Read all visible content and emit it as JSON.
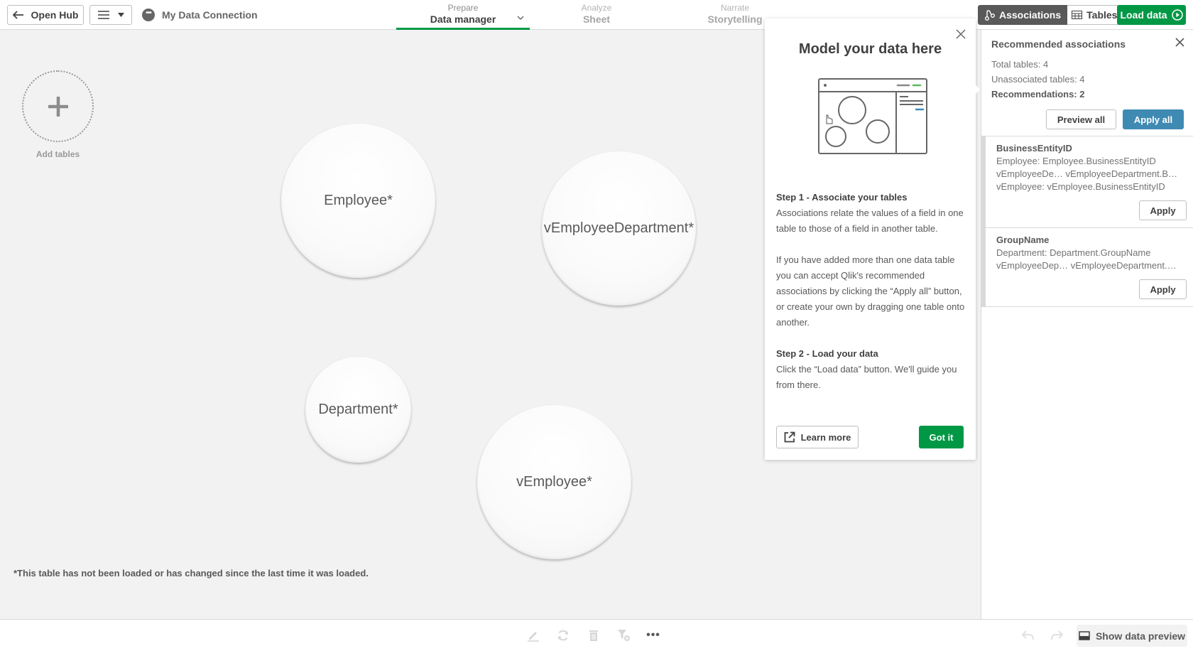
{
  "topbar": {
    "open_hub_label": "Open Hub",
    "connection_label": "My Data Connection",
    "nav": [
      {
        "small": "Prepare",
        "big": "Data manager"
      },
      {
        "small": "Analyze",
        "big": "Sheet"
      },
      {
        "small": "Narrate",
        "big": "Storytelling"
      }
    ],
    "associations_label": "Associations",
    "tables_label": "Tables",
    "load_data_label": "Load data",
    "accent_green": "#009845"
  },
  "canvas": {
    "add_tables_label": "Add tables",
    "tables": [
      {
        "name": "Employee*"
      },
      {
        "name": "vEmployeeDepartment*"
      },
      {
        "name": "Department*"
      },
      {
        "name": "vEmployee*"
      }
    ],
    "footnote": "*This table has not been loaded or has changed since the last time it was loaded."
  },
  "popup": {
    "title": "Model your data here",
    "step1_heading": "Step 1 - Associate your tables",
    "step1_text": "Associations relate the values of a field in one table to those of a field in another table.",
    "step1_text2": "If you have added more than one data table you can accept Qlik's recommended associations by clicking the “Apply all” button, or create your own by dragging one table onto another.",
    "step2_heading": "Step 2 - Load your data",
    "step2_text": "Click the “Load data” button. We'll guide you from there.",
    "learn_more_label": "Learn more",
    "got_it_label": "Got it"
  },
  "panel": {
    "title": "Recommended associations",
    "total_tables": "Total tables: 4",
    "unassociated_tables": "Unassociated tables: 4",
    "recommendations": "Recommendations: 2",
    "preview_all_label": "Preview all",
    "apply_all_label": "Apply all",
    "apply_all_color": "#3f8ab3",
    "recommendations_list": [
      {
        "field": "BusinessEntityID",
        "lines": [
          "Employee: Employee.BusinessEntityID",
          "vEmployeeDe…  vEmployeeDepartment.B…",
          "vEmployee: vEmployee.BusinessEntityID"
        ],
        "apply_label": "Apply"
      },
      {
        "field": "GroupName",
        "lines": [
          "Department: Department.GroupName",
          "vEmployeeDep…  vEmployeeDepartment.…"
        ],
        "apply_label": "Apply"
      }
    ]
  },
  "bottombar": {
    "show_data_preview_label": "Show data preview",
    "more_label": "•••"
  }
}
